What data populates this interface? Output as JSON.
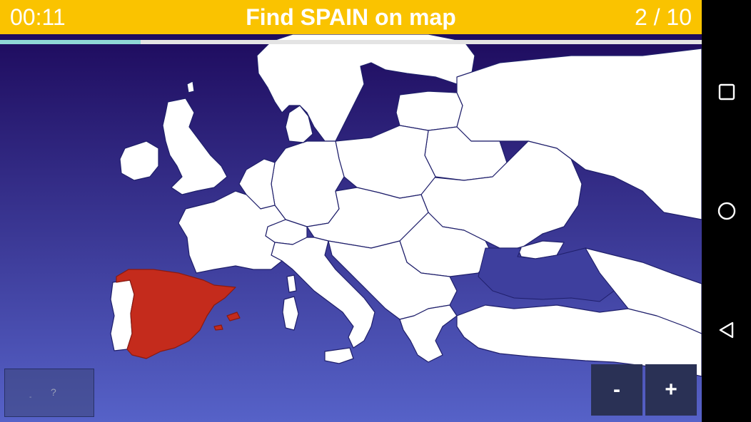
{
  "topbar": {
    "timer": "00:11",
    "title": "Find SPAIN on map",
    "progress": "2 / 10"
  },
  "quiz": {
    "current_question": 2,
    "total_questions": 10,
    "time_bar_fraction": 0.2
  },
  "map": {
    "target_country": "Spain",
    "colors": {
      "sea_top": "#1e0b5e",
      "sea_bottom": "#5662c8",
      "land": "#ffffff",
      "border": "#1f1f6b",
      "highlight": "#c42b1c"
    }
  },
  "controls": {
    "hint_label": "?",
    "hint_sub": "-",
    "zoom_out_label": "-",
    "zoom_in_label": "+"
  },
  "navbar": {
    "recents_icon": "square-icon",
    "home_icon": "circle-icon",
    "back_icon": "triangle-back-icon"
  }
}
